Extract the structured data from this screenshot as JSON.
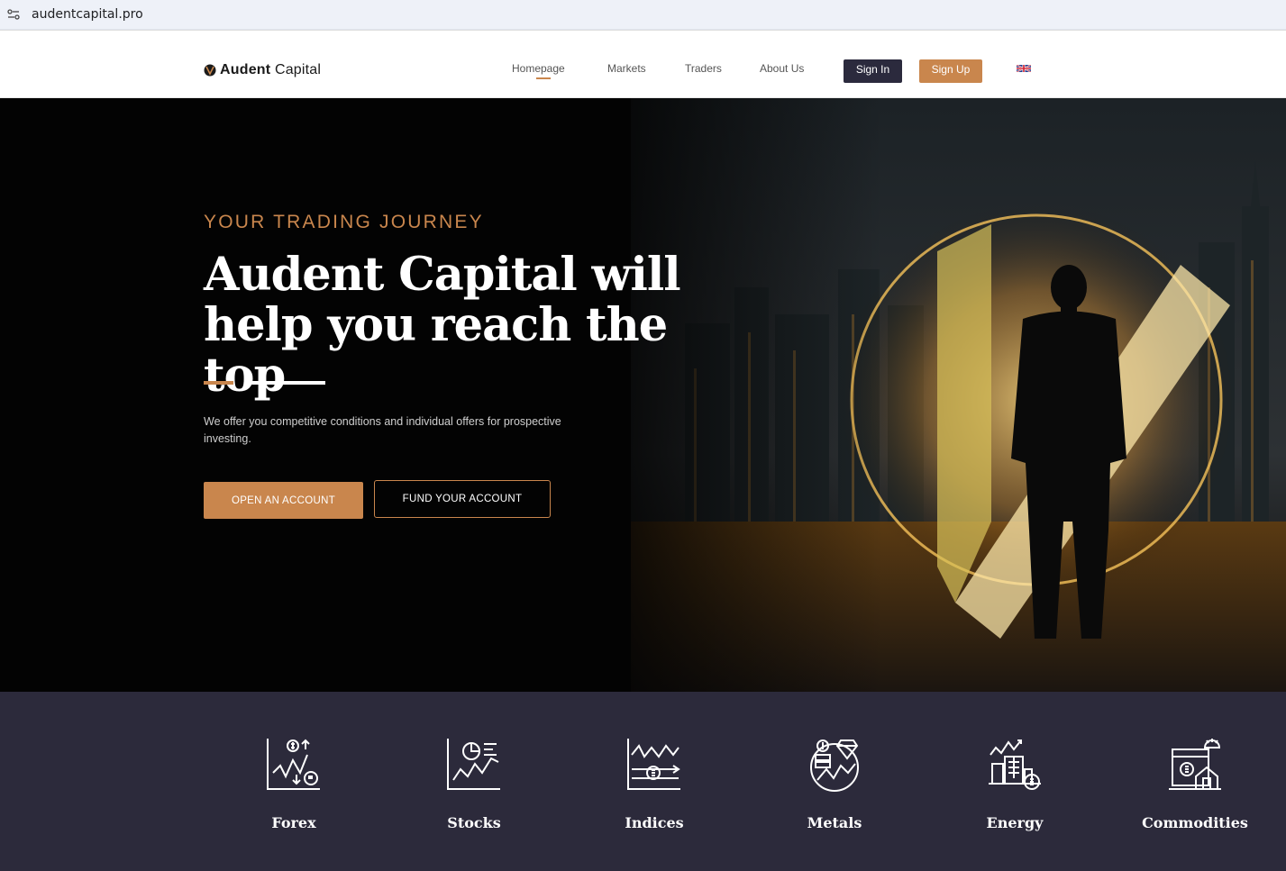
{
  "browser": {
    "url": "audentcapital.pro",
    "site_icon": "site-settings-icon"
  },
  "header": {
    "logo_text_bold": "Audent",
    "logo_text_rest": " Capital",
    "nav": [
      {
        "label": "Homepage",
        "active": true
      },
      {
        "label": "Markets",
        "active": false
      },
      {
        "label": "Traders",
        "active": false
      },
      {
        "label": "About Us",
        "active": false
      }
    ],
    "signin_label": "Sign In",
    "signup_label": "Sign Up",
    "language_icon": "uk-flag-icon"
  },
  "hero": {
    "eyebrow": "YOUR TRADING JOURNEY",
    "headline_line1": "Audent Capital will",
    "headline_line2": "help you reach the top",
    "subtitle": "We offer you competitive conditions and individual offers for prospective investing.",
    "open_account_label": "OPEN AN ACCOUNT",
    "fund_account_label": "FUND YOUR ACCOUNT"
  },
  "markets": [
    {
      "label": "Forex",
      "icon": "forex-chart-icon"
    },
    {
      "label": "Stocks",
      "icon": "stocks-chart-icon"
    },
    {
      "label": "Indices",
      "icon": "indices-chart-icon"
    },
    {
      "label": "Metals",
      "icon": "metals-diamond-icon"
    },
    {
      "label": "Energy",
      "icon": "energy-building-icon"
    },
    {
      "label": "Commodities",
      "icon": "commodities-house-icon"
    }
  ],
  "colors": {
    "accent": "#c9864d",
    "dark_button": "#2b2a3d",
    "markets_bg": "#2c2a3b",
    "hero_bg": "#030303"
  }
}
